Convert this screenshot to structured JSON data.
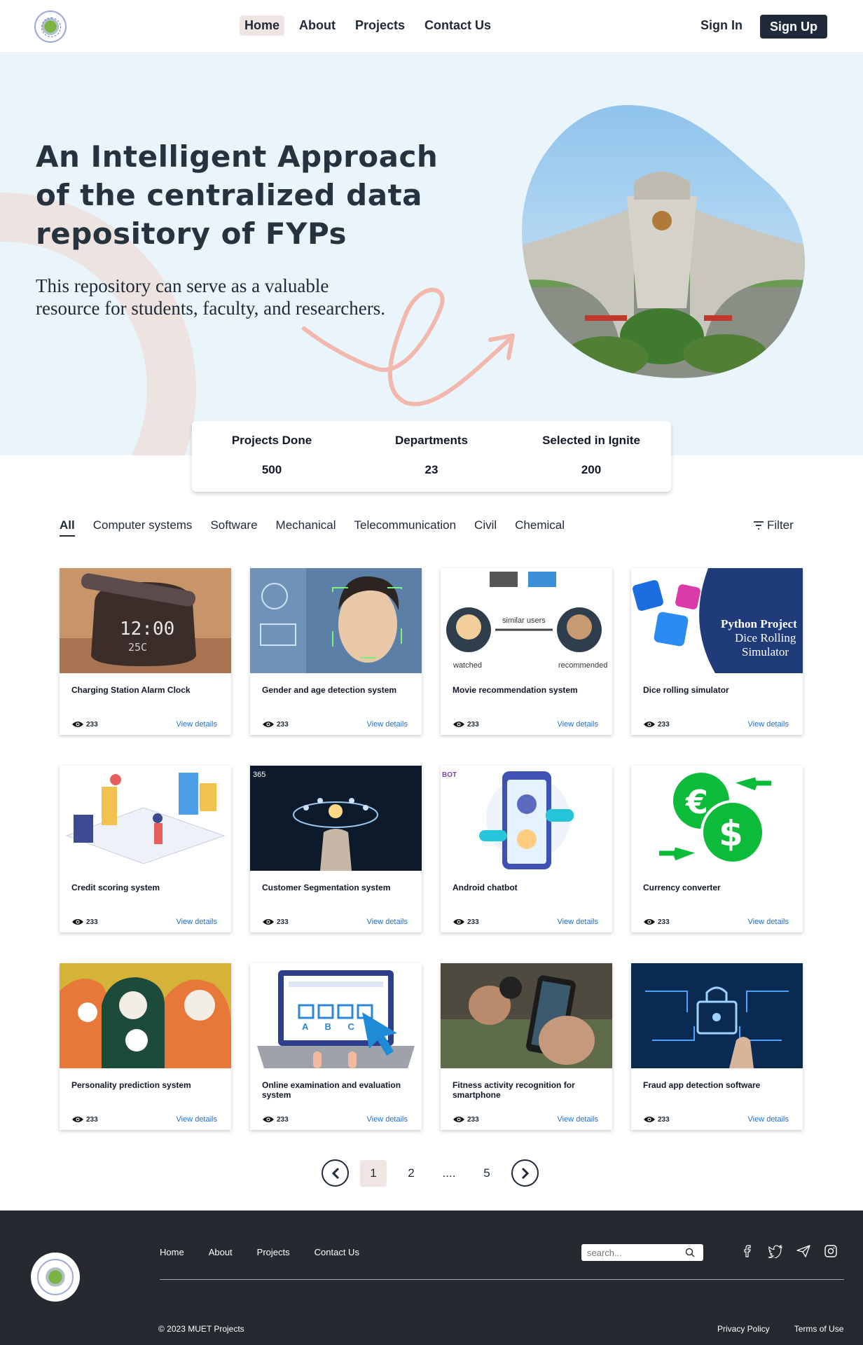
{
  "nav": {
    "items": [
      {
        "label": "Home",
        "active": true
      },
      {
        "label": "About",
        "active": false
      },
      {
        "label": "Projects",
        "active": false
      },
      {
        "label": "Contact Us",
        "active": false
      }
    ],
    "sign_in": "Sign In",
    "sign_up": "Sign Up"
  },
  "hero": {
    "title": "An Intelligent Approach of the centralized data repository of FYPs",
    "subtitle": "This repository can serve as a valuable resource for students, faculty, and researchers."
  },
  "stats": [
    {
      "label": "Projects Done",
      "value": "500"
    },
    {
      "label": "Departments",
      "value": "23"
    },
    {
      "label": "Selected in Ignite",
      "value": "200"
    }
  ],
  "tabs": [
    {
      "label": "All",
      "active": true
    },
    {
      "label": "Computer systems",
      "active": false
    },
    {
      "label": "Software",
      "active": false
    },
    {
      "label": "Mechanical",
      "active": false
    },
    {
      "label": "Telecommunication",
      "active": false
    },
    {
      "label": "Civil",
      "active": false
    },
    {
      "label": "Chemical",
      "active": false
    }
  ],
  "filter_label": "Filter",
  "cards": [
    {
      "title": "Charging Station Alarm Clock",
      "views": "233",
      "link": "View details",
      "icon": "clock",
      "img_text": "12:00"
    },
    {
      "title": "Gender and age detection system",
      "views": "233",
      "link": "View details",
      "icon": "face-scan",
      "img_text": ""
    },
    {
      "title": "Movie recommendation system",
      "views": "233",
      "link": "View details",
      "icon": "recommend",
      "img_text": "similar users"
    },
    {
      "title": "Dice rolling simulator",
      "views": "233",
      "link": "View details",
      "icon": "dice",
      "img_text": "Python Project Dice Rolling Simulator"
    },
    {
      "title": "Credit scoring system",
      "views": "233",
      "link": "View details",
      "icon": "credit",
      "img_text": ""
    },
    {
      "title": "Customer Segmentation system",
      "views": "233",
      "link": "View details",
      "icon": "network",
      "img_text": "365"
    },
    {
      "title": "Android chatbot",
      "views": "233",
      "link": "View details",
      "icon": "chatbot",
      "img_text": "BOT"
    },
    {
      "title": "Currency converter",
      "views": "233",
      "link": "View details",
      "icon": "currency",
      "img_text": ""
    },
    {
      "title": "Personality prediction system",
      "views": "233",
      "link": "View details",
      "icon": "heads",
      "img_text": ""
    },
    {
      "title": "Online examination and evaluation system",
      "views": "233",
      "link": "View details",
      "icon": "exam",
      "img_text": "A B C D"
    },
    {
      "title": "Fitness activity recognition for smartphone",
      "views": "233",
      "link": "View details",
      "icon": "fitness",
      "img_text": ""
    },
    {
      "title": "Fraud app detection software",
      "views": "233",
      "link": "View details",
      "icon": "fraud",
      "img_text": ""
    }
  ],
  "pagination": [
    "1",
    "2",
    "....",
    "5"
  ],
  "footer": {
    "nav": [
      "Home",
      "About",
      "Projects",
      "Contact Us"
    ],
    "search_placeholder": "search...",
    "copyright": "© 2023  MUET Projects",
    "privacy": "Privacy Policy",
    "terms": "Terms of Use"
  },
  "colors": {
    "accent": "#1e2a3a",
    "hero_bg": "#eaf4fb",
    "link": "#1d6fd6",
    "footer_bg": "#252a31",
    "squiggle": "#f2b8ad"
  }
}
